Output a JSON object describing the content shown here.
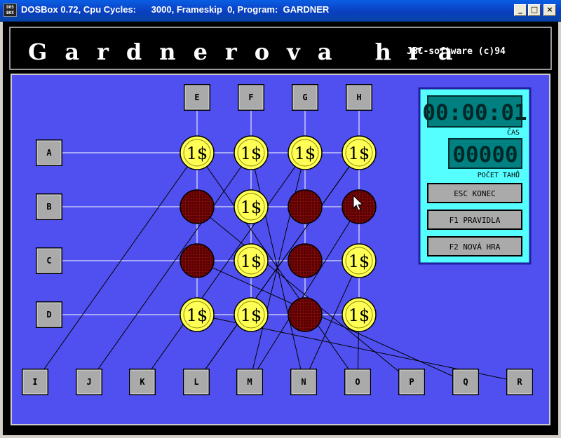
{
  "window": {
    "title": "DOSBox 0.72, Cpu Cycles:      3000, Frameskip  0, Program:  GARDNER",
    "icon_text": "DOS BOX",
    "min_label": "_",
    "max_label": "□",
    "close_label": "×"
  },
  "game": {
    "title": "Gardnerova hra",
    "copyright": "JBC-software (c)94",
    "top_labels": [
      "E",
      "F",
      "G",
      "H"
    ],
    "left_labels": [
      "A",
      "B",
      "C",
      "D"
    ],
    "bottom_labels": [
      "I",
      "J",
      "K",
      "L",
      "M",
      "N",
      "O",
      "P",
      "Q",
      "R"
    ],
    "grid": [
      [
        "coin",
        "coin",
        "coin",
        "coin"
      ],
      [
        "empty",
        "coin",
        "empty",
        "empty"
      ],
      [
        "empty",
        "coin",
        "empty",
        "coin"
      ],
      [
        "coin",
        "coin",
        "empty",
        "coin"
      ]
    ],
    "coin_label": "1$",
    "colors": {
      "board": "#5050f0",
      "coin": "#ffff55",
      "hole": "#5a0000",
      "panel": "#55ffff",
      "lcd": "#008080",
      "lcd_text": "#002828"
    }
  },
  "panel": {
    "time": "00:00:01",
    "time_label": "ČAS",
    "moves": "00000",
    "moves_label": "POČET TAHŮ",
    "buttons": [
      "ESC KONEC",
      "F1 PRAVIDLA",
      "F2 NOVÁ HRA"
    ]
  }
}
